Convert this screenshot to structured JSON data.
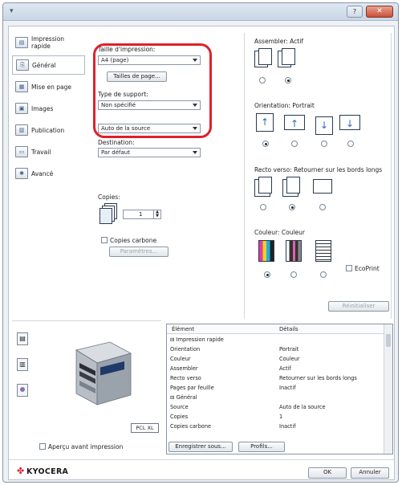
{
  "window": {
    "close_label": "✕",
    "help_label": "?"
  },
  "sidebar": {
    "items": [
      {
        "label": "Impression rapide",
        "icon": "quick-print-icon"
      },
      {
        "label": "Général",
        "icon": "general-icon"
      },
      {
        "label": "Mise en page",
        "icon": "layout-icon"
      },
      {
        "label": "Images",
        "icon": "images-icon"
      },
      {
        "label": "Publication",
        "icon": "publishing-icon"
      },
      {
        "label": "Travail",
        "icon": "job-icon"
      },
      {
        "label": "Avancé",
        "icon": "advanced-icon"
      }
    ]
  },
  "left": {
    "print_size_label": "Taille d'impression:",
    "print_size_value": "A4 (page)",
    "page_sizes_button": "Tailles de page...",
    "media_type_label": "Type de support:",
    "media_type_value": "Non spécifié",
    "source_value": "Auto de la source",
    "destination_label": "Destination:",
    "destination_value": "Par défaut",
    "copies_label": "Copies:",
    "copies_value": "1",
    "carbon_copies_label": "Copies carbone",
    "parameters_button": "Paramètres..."
  },
  "right": {
    "collate_label": "Assembler: Actif",
    "orientation_label": "Orientation: Portrait",
    "duplex_label": "Recto verso: Retourner sur les bords longs",
    "color_label": "Couleur: Couleur",
    "ecoprint_label": "EcoPrint",
    "reset_button": "Réinitialiser"
  },
  "preview": {
    "badge": "PCL XL",
    "preview_checkbox_label": "Aperçu avant impression"
  },
  "details": {
    "col_element": "Élément",
    "col_details": "Détails",
    "rows": [
      {
        "c0": "⊟ Impression rapide",
        "c1": ""
      },
      {
        "c0": "      Orientation",
        "c1": "Portrait"
      },
      {
        "c0": "      Couleur",
        "c1": "Couleur"
      },
      {
        "c0": "      Assembler",
        "c1": "Actif"
      },
      {
        "c0": "      Recto verso",
        "c1": "Retourner sur les bords longs"
      },
      {
        "c0": "      Pages par feuille",
        "c1": "Inactif"
      },
      {
        "c0": "⊟ Général",
        "c1": ""
      },
      {
        "c0": "      Source",
        "c1": "Auto de la source"
      },
      {
        "c0": "      Copies",
        "c1": "1"
      },
      {
        "c0": "      Copies carbone",
        "c1": "Inactif"
      }
    ]
  },
  "footer": {
    "save_as_button": "Enregistrer sous...",
    "profile_button": "Profils...",
    "ok_button": "OK",
    "cancel_button": "Annuler",
    "logo": "KYOCERA"
  },
  "colors": {
    "highlight": "#e0202a",
    "logo": "#e0202a"
  }
}
